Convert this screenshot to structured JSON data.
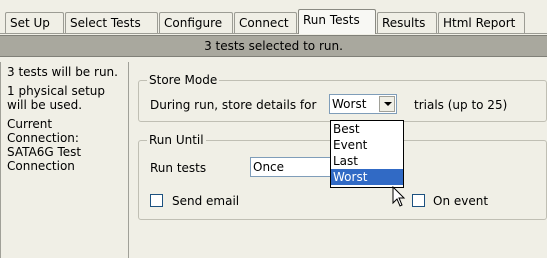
{
  "tabs": [
    {
      "label": "Set Up"
    },
    {
      "label": "Select Tests"
    },
    {
      "label": "Configure"
    },
    {
      "label": "Connect"
    },
    {
      "label": "Run Tests"
    },
    {
      "label": "Results"
    },
    {
      "label": "Html Report"
    }
  ],
  "status": "3 tests selected to run.",
  "left": {
    "line1": "3 tests will be run.",
    "line2": "1 physical setup will be used.",
    "line3": "Current Connection: SATA6G Test Connection"
  },
  "store_mode": {
    "legend": "Store Mode",
    "prefix": "During run, store details for",
    "selected": "Worst",
    "suffix": "trials (up to 25)",
    "options": [
      "Best",
      "Event",
      "Last",
      "Worst"
    ]
  },
  "run_until": {
    "legend": "Run Until",
    "label": "Run tests",
    "selected": "Once",
    "send_email": "Send email",
    "on_event": "On event"
  }
}
